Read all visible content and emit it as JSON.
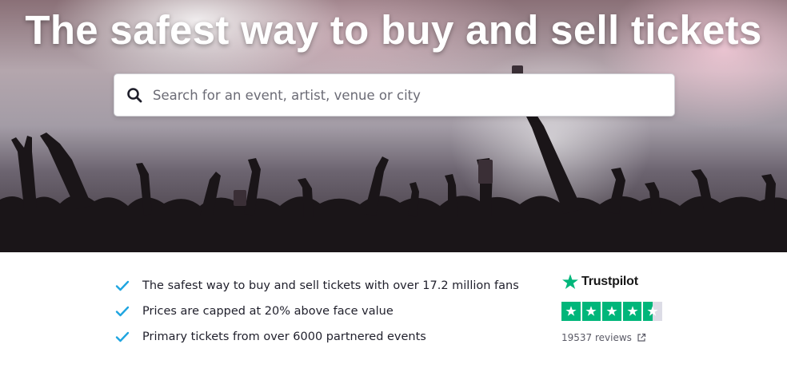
{
  "hero": {
    "title": "The safest way to buy and sell tickets",
    "search": {
      "placeholder": "Search for an event, artist, venue or city",
      "value": "",
      "icon": "search-icon"
    }
  },
  "features": [
    {
      "icon": "check-icon",
      "text": "The safest way to buy and sell tickets with over 17.2 million fans"
    },
    {
      "icon": "check-icon",
      "text": "Prices are capped at 20% above face value"
    },
    {
      "icon": "check-icon",
      "text": "Primary tickets from over 6000 partnered events"
    }
  ],
  "trustpilot": {
    "brand": "Trustpilot",
    "rating": 4.5,
    "max_rating": 5,
    "reviews_label": "19537 reviews",
    "link_icon": "external-link-icon"
  },
  "colors": {
    "check": "#1fa5e0",
    "trustpilot_green": "#00b67a",
    "trustpilot_empty": "#dcdce6",
    "title_text": "#ffffff"
  }
}
